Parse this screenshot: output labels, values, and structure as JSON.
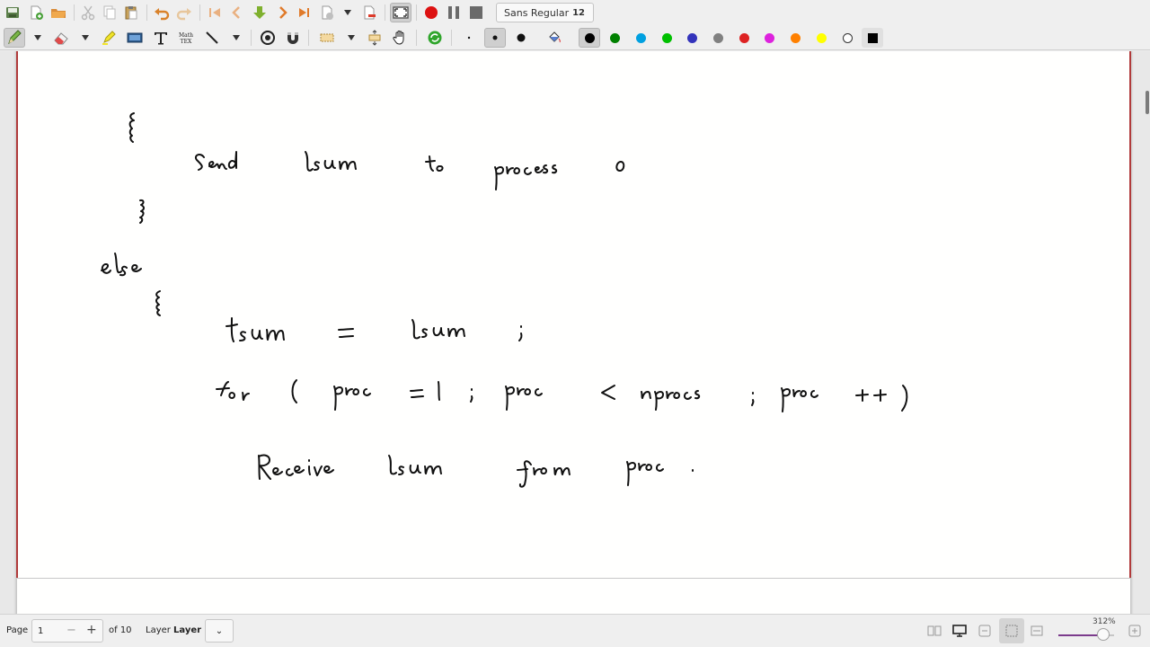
{
  "toolbar": {
    "font_name": "Sans Regular",
    "font_size": "12",
    "colors": [
      "#000000",
      "#008000",
      "#00a0e0",
      "#00c000",
      "#3333bb",
      "#808080",
      "#dd2222",
      "#dd22dd",
      "#ff8000",
      "#ffff00",
      "#ffffff"
    ],
    "selected_color": "#000000",
    "record_color": "#dd1111"
  },
  "statusbar": {
    "page_label": "Page",
    "page_value": "1",
    "page_total": "of 10",
    "layer_label": "Layer",
    "layer_value": "Layer 1",
    "zoom_label": "312%",
    "zoom_fraction": 0.8
  },
  "page": {
    "border_color": "#b03a3a",
    "handwriting": [
      "{",
      "Send lsum to process 0",
      "}",
      "else",
      "{",
      "tsum = lsum;",
      "for( proc = 1 ; proc < nprocs ; proc ++)",
      "Receive lsum from proc."
    ]
  }
}
